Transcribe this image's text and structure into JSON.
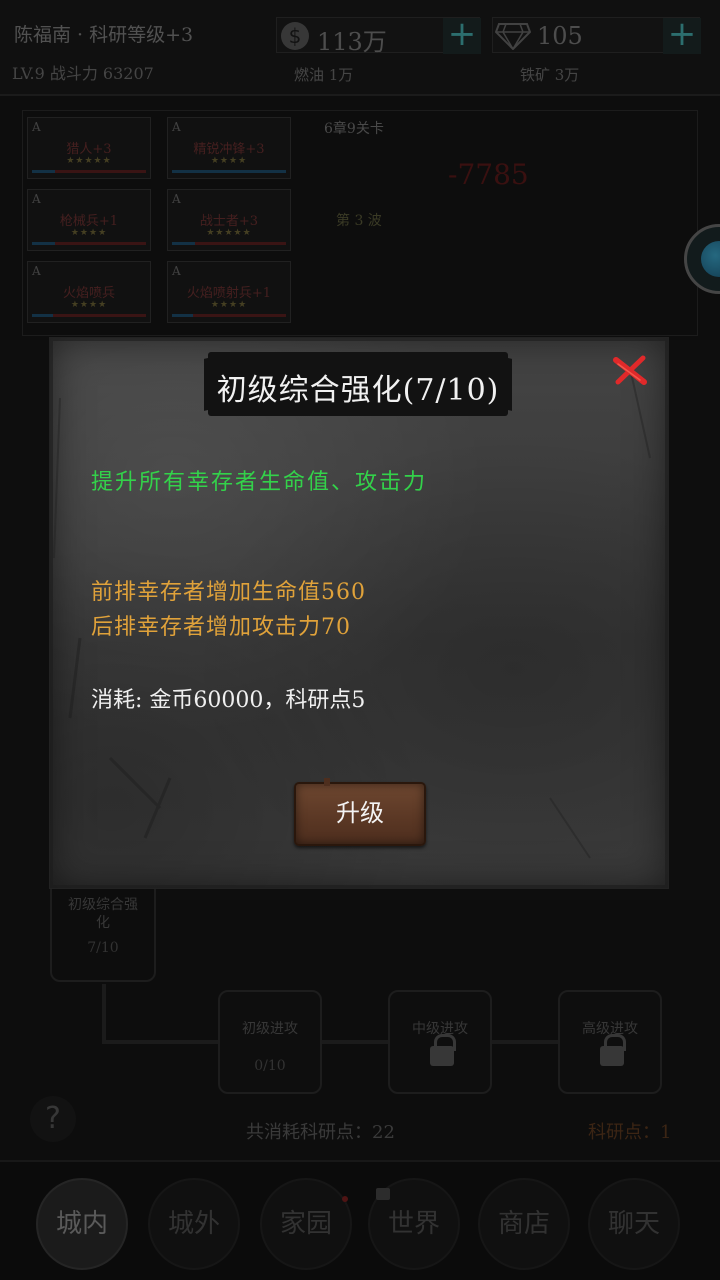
{
  "header": {
    "player_name": "陈福南 · 科研等级+3",
    "power_label": "LV.9 战斗力 63207",
    "gold": {
      "icon": "dollar-coin-icon",
      "value": "113万"
    },
    "diamonds": {
      "icon": "diamond-icon",
      "value": "105"
    },
    "fuel": "燃油 1万",
    "iron": "铁矿 3万"
  },
  "battle": {
    "heroes": [
      {
        "rank": "A",
        "name": "猎人+3",
        "stars": "★★★★★"
      },
      {
        "rank": "A",
        "name": "精锐冲锋+3",
        "stars": "★★★★"
      },
      {
        "rank": "A",
        "name": "枪械兵+1",
        "stars": "★★★★"
      },
      {
        "rank": "A",
        "name": "战士者+3",
        "stars": "★★★★★"
      },
      {
        "rank": "A",
        "name": "火焰喷兵",
        "stars": "★★★★"
      },
      {
        "rank": "A",
        "name": "火焰喷射兵+1",
        "stars": "★★★★"
      }
    ],
    "stage": "6章9关卡",
    "damage": "-7785",
    "wave": "第 3 波"
  },
  "tech_tree": {
    "root": {
      "title": "初级综合强化",
      "level": "7/10"
    },
    "nodes": [
      {
        "title": "初级进攻",
        "level": "0/10",
        "locked": false
      },
      {
        "title": "中级进攻",
        "level": "",
        "locked": true
      },
      {
        "title": "高级进攻",
        "level": "",
        "locked": true
      }
    ],
    "help": "?",
    "total_cost": "共消耗科研点：22",
    "points_left": "科研点：1"
  },
  "nav": {
    "items": [
      "城内",
      "城外",
      "家园",
      "世界",
      "商店",
      "聊天"
    ],
    "active": 0
  },
  "dialog": {
    "title": "初级综合强化(7/10)",
    "description": "提升所有幸存者生命值、攻击力",
    "effects": [
      "前排幸存者增加生命值560",
      "后排幸存者增加攻击力70"
    ],
    "cost": "消耗: 金币60000，科研点5",
    "upgrade_label": "升级",
    "colors": {
      "description": "#33d24a",
      "effect": "#e0a23a",
      "close": "#e0292a"
    }
  }
}
